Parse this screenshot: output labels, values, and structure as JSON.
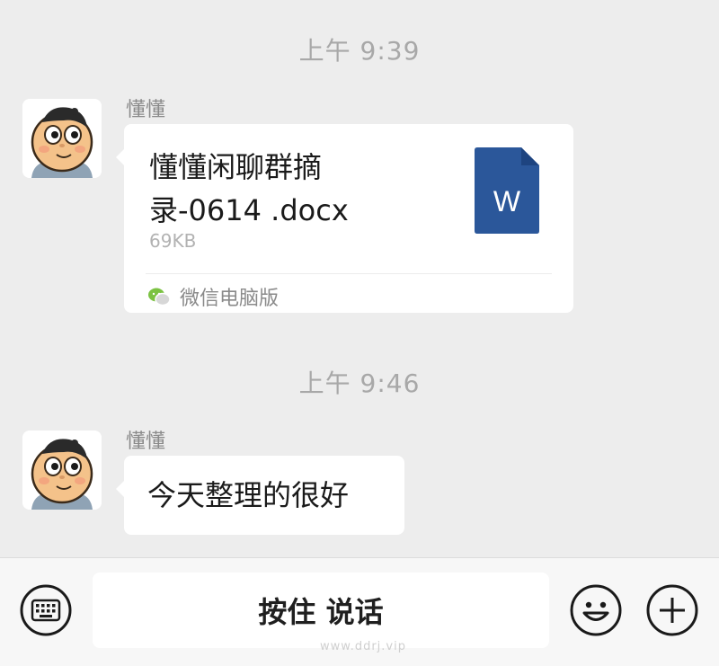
{
  "messages": [
    {
      "timestamp": "上午 9:39",
      "sender": "懂懂",
      "file": {
        "name_line1": "懂懂闲聊群摘",
        "name_line2": "录-0614 .docx",
        "size": "69KB",
        "icon": "word-doc-icon",
        "icon_letter": "W",
        "source": "微信电脑版"
      }
    },
    {
      "timestamp": "上午 9:46",
      "sender": "懂懂",
      "text": "今天整理的很好"
    }
  ],
  "input_bar": {
    "voice_label": "按住 说话",
    "left_icon": "keyboard-icon",
    "right_icons": [
      "emoji-icon",
      "plus-icon"
    ]
  },
  "watermark": "www.ddrj.vip",
  "colors": {
    "background": "#ededed",
    "bubble": "#ffffff",
    "word_blue": "#2b579a",
    "wechat_green": "#7bc242"
  }
}
